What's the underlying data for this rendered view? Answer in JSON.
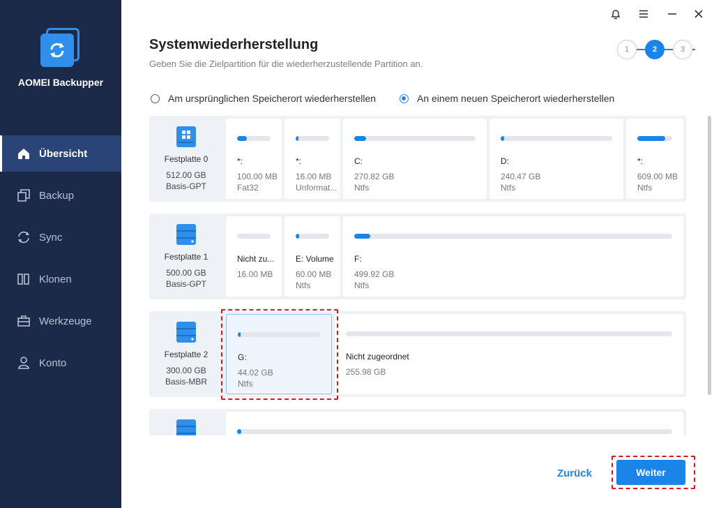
{
  "app": {
    "name": "AOMEI Backupper"
  },
  "sidebar": {
    "items": [
      {
        "label": "Übersicht",
        "icon": "home-icon"
      },
      {
        "label": "Backup",
        "icon": "backup-icon"
      },
      {
        "label": "Sync",
        "icon": "sync-icon"
      },
      {
        "label": "Klonen",
        "icon": "clone-icon"
      },
      {
        "label": "Werkzeuge",
        "icon": "tools-icon"
      },
      {
        "label": "Konto",
        "icon": "user-icon"
      }
    ]
  },
  "page": {
    "title": "Systemwiederherstellung",
    "subtitle": "Geben Sie die Zielpartition für die wiederherzustellende Partition an."
  },
  "steps": [
    "1",
    "2",
    "3"
  ],
  "options": {
    "original": "Am ursprünglichen Speicherort wiederherstellen",
    "new": "An einem neuen Speicherort wiederherstellen"
  },
  "disks": [
    {
      "name": "Festplatte 0",
      "size": "512.00 GB",
      "type": "Basis-GPT",
      "partitions": [
        {
          "label": "*:",
          "size": "100.00 MB",
          "fs": "Fat32",
          "fill": 0.3
        },
        {
          "label": "*:",
          "size": "16.00 MB",
          "fs": "Unformat...",
          "fill": 0.05
        },
        {
          "label": "C:",
          "size": "270.82 GB",
          "fs": "Ntfs",
          "fill": 0.1
        },
        {
          "label": "D:",
          "size": "240.47 GB",
          "fs": "Ntfs",
          "fill": 0.02
        },
        {
          "label": "*:",
          "size": "609.00 MB",
          "fs": "Ntfs",
          "fill": 0.8
        }
      ]
    },
    {
      "name": "Festplatte 1",
      "size": "500.00 GB",
      "type": "Basis-GPT",
      "partitions": [
        {
          "label": "Nicht zu...",
          "size": "16.00 MB",
          "fs": "",
          "fill": 0
        },
        {
          "label": "E: Volume",
          "size": "60.00 MB",
          "fs": "Ntfs",
          "fill": 0.1
        },
        {
          "label": "F:",
          "size": "499.92 GB",
          "fs": "Ntfs",
          "fill": 0.05
        }
      ]
    },
    {
      "name": "Festplatte 2",
      "size": "300.00 GB",
      "type": "Basis-MBR",
      "partitions": [
        {
          "label": "G:",
          "size": "44.02 GB",
          "fs": "Ntfs",
          "fill": 0.02
        },
        {
          "label": "Nicht zugeordnet",
          "size": "255.98 GB",
          "fs": "",
          "fill": 0
        }
      ]
    }
  ],
  "buttons": {
    "back": "Zurück",
    "next": "Weiter"
  }
}
